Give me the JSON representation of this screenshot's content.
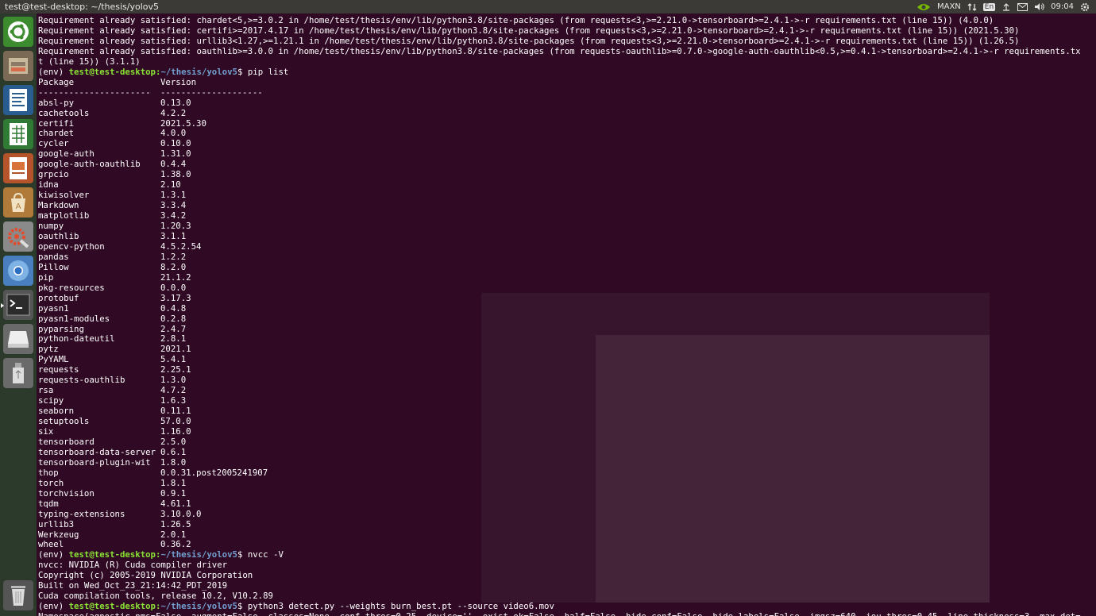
{
  "window_title": "test@test-desktop: ~/thesis/yolov5",
  "tray": {
    "power_mode": "MAXN",
    "language": "En",
    "clock": "09:04"
  },
  "launcher": [
    "ubuntu-dash",
    "file-manager",
    "writer",
    "calc",
    "impress",
    "software-center",
    "system-settings",
    "chromium",
    "terminal",
    "disk",
    "usb-drive",
    "trash"
  ],
  "prompt": {
    "env": "(env) ",
    "user": "test@test-desktop",
    "path": "~/thesis/yolov5",
    "symbol": "$ "
  },
  "top_lines": [
    "Requirement already satisfied: chardet<5,>=3.0.2 in /home/test/thesis/env/lib/python3.8/site-packages (from requests<3,>=2.21.0->tensorboard>=2.4.1->-r requirements.txt (line 15)) (4.0.0)",
    "Requirement already satisfied: certifi>=2017.4.17 in /home/test/thesis/env/lib/python3.8/site-packages (from requests<3,>=2.21.0->tensorboard>=2.4.1->-r requirements.txt (line 15)) (2021.5.30)",
    "Requirement already satisfied: urllib3<1.27,>=1.21.1 in /home/test/thesis/env/lib/python3.8/site-packages (from requests<3,>=2.21.0->tensorboard>=2.4.1->-r requirements.txt (line 15)) (1.26.5)",
    "Requirement already satisfied: oauthlib>=3.0.0 in /home/test/thesis/env/lib/python3.8/site-packages (from requests-oauthlib>=0.7.0->google-auth-oauthlib<0.5,>=0.4.1->tensorboard>=2.4.1->-r requirements.tx",
    "t (line 15)) (3.1.1)"
  ],
  "cmd_pip": "pip list",
  "pip_header": {
    "package": "Package",
    "version": "Version"
  },
  "pip_rule": {
    "package": "----------------------",
    "version": "--------------------"
  },
  "packages": [
    [
      "absl-py",
      "0.13.0"
    ],
    [
      "cachetools",
      "4.2.2"
    ],
    [
      "certifi",
      "2021.5.30"
    ],
    [
      "chardet",
      "4.0.0"
    ],
    [
      "cycler",
      "0.10.0"
    ],
    [
      "google-auth",
      "1.31.0"
    ],
    [
      "google-auth-oauthlib",
      "0.4.4"
    ],
    [
      "grpcio",
      "1.38.0"
    ],
    [
      "idna",
      "2.10"
    ],
    [
      "kiwisolver",
      "1.3.1"
    ],
    [
      "Markdown",
      "3.3.4"
    ],
    [
      "matplotlib",
      "3.4.2"
    ],
    [
      "numpy",
      "1.20.3"
    ],
    [
      "oauthlib",
      "3.1.1"
    ],
    [
      "opencv-python",
      "4.5.2.54"
    ],
    [
      "pandas",
      "1.2.2"
    ],
    [
      "Pillow",
      "8.2.0"
    ],
    [
      "pip",
      "21.1.2"
    ],
    [
      "pkg-resources",
      "0.0.0"
    ],
    [
      "protobuf",
      "3.17.3"
    ],
    [
      "pyasn1",
      "0.4.8"
    ],
    [
      "pyasn1-modules",
      "0.2.8"
    ],
    [
      "pyparsing",
      "2.4.7"
    ],
    [
      "python-dateutil",
      "2.8.1"
    ],
    [
      "pytz",
      "2021.1"
    ],
    [
      "PyYAML",
      "5.4.1"
    ],
    [
      "requests",
      "2.25.1"
    ],
    [
      "requests-oauthlib",
      "1.3.0"
    ],
    [
      "rsa",
      "4.7.2"
    ],
    [
      "scipy",
      "1.6.3"
    ],
    [
      "seaborn",
      "0.11.1"
    ],
    [
      "setuptools",
      "57.0.0"
    ],
    [
      "six",
      "1.16.0"
    ],
    [
      "tensorboard",
      "2.5.0"
    ],
    [
      "tensorboard-data-server",
      "0.6.1"
    ],
    [
      "tensorboard-plugin-wit",
      "1.8.0"
    ],
    [
      "thop",
      "0.0.31.post2005241907"
    ],
    [
      "torch",
      "1.8.1"
    ],
    [
      "torchvision",
      "0.9.1"
    ],
    [
      "tqdm",
      "4.61.1"
    ],
    [
      "typing-extensions",
      "3.10.0.0"
    ],
    [
      "urllib3",
      "1.26.5"
    ],
    [
      "Werkzeug",
      "2.0.1"
    ],
    [
      "wheel",
      "0.36.2"
    ]
  ],
  "cmd_nvcc": "nvcc -V",
  "nvcc_lines": [
    "nvcc: NVIDIA (R) Cuda compiler driver",
    "Copyright (c) 2005-2019 NVIDIA Corporation",
    "Built on Wed_Oct_23_21:14:42_PDT_2019",
    "Cuda compilation tools, release 10.2, V10.2.89"
  ],
  "cmd_detect": "python3 detect.py --weights burn_best.pt --source video6.mov",
  "last_line": "Namespace(agnostic_nms=False, augment=False, classes=None, conf_thres=0.25, device='', exist_ok=False, half=False, hide_conf=False, hide_labels=False, imgsz=640, iou_thres=0.45, line_thickness=3, max_det="
}
